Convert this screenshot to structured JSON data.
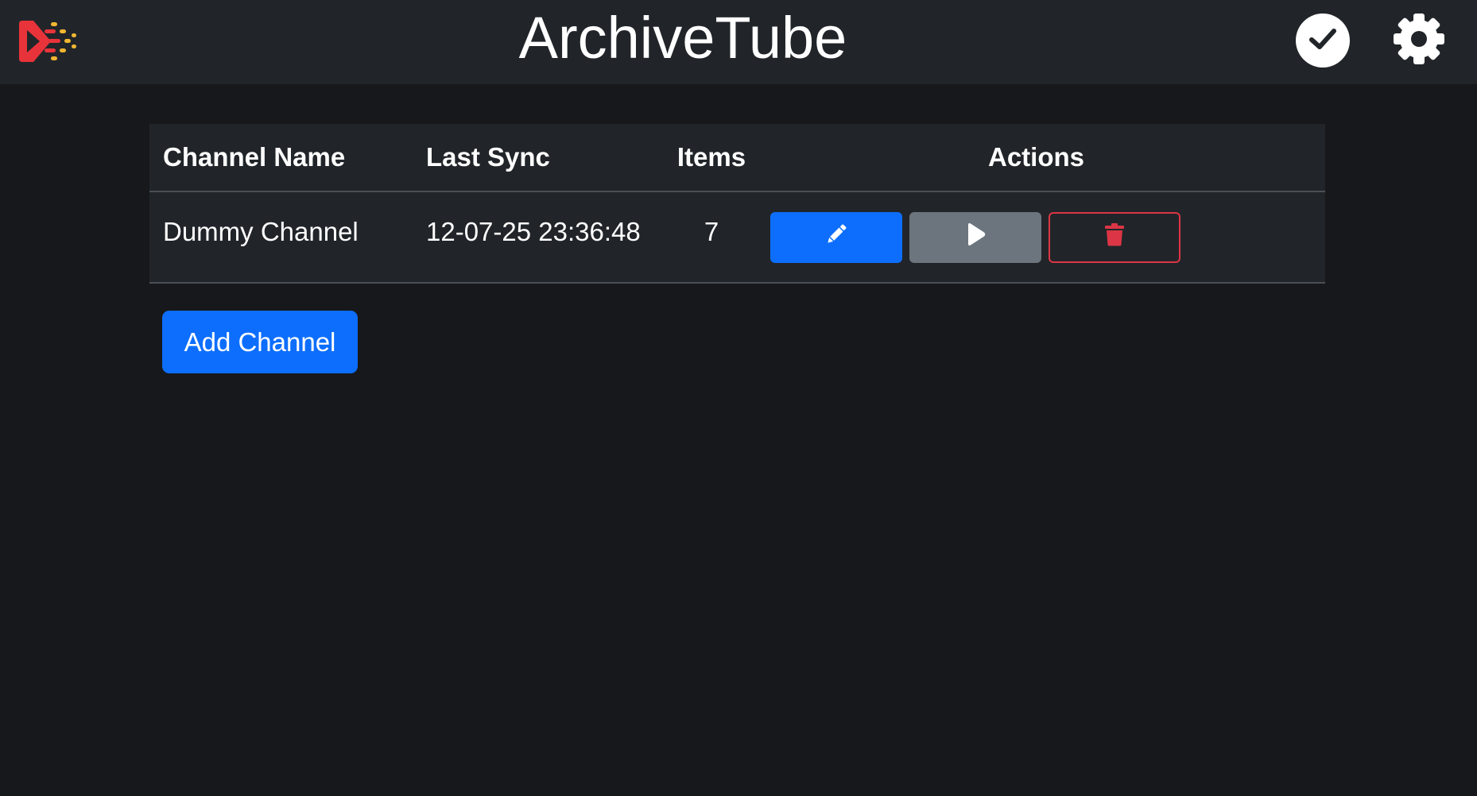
{
  "header": {
    "title": "ArchiveTube",
    "logo_icon": "archivetube-logo",
    "status_icon": "check-circle-icon",
    "settings_icon": "gear-icon"
  },
  "table": {
    "columns": [
      "Channel Name",
      "Last Sync",
      "Items",
      "Actions"
    ],
    "rows": [
      {
        "channel_name": "Dummy Channel",
        "last_sync": "12-07-25 23:36:48",
        "items": "7"
      }
    ]
  },
  "actions": {
    "edit_icon": "pencil-icon",
    "play_icon": "play-icon",
    "delete_icon": "trash-icon"
  },
  "add_channel_label": "Add Channel",
  "colors": {
    "background": "#17181b",
    "header": "#212529",
    "primary": "#0d6efd",
    "secondary": "#6c757d",
    "danger": "#dc3545",
    "logo_red": "#e8333a",
    "logo_yellow": "#f1b631"
  }
}
